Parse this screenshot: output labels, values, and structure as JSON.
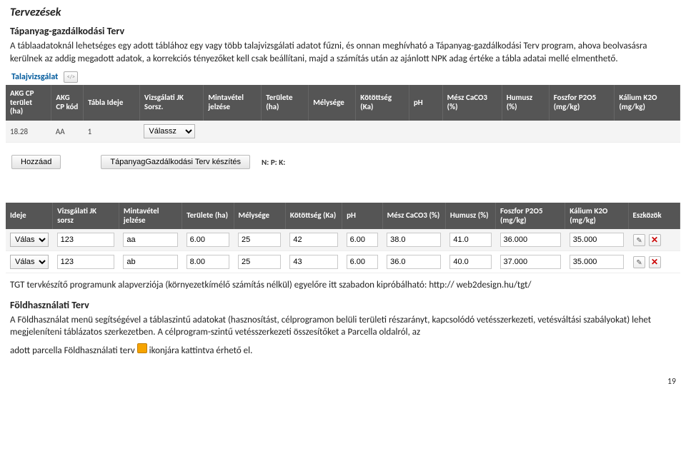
{
  "heading_main": "Tervezések",
  "heading_sub1": "Tápanyag-gazdálkodási Terv",
  "intro_para1": "A táblaadatoknál lehetséges egy adott táblához egy vagy több talajvizsgálati adatot fűzni, és onnan meghívható a Tápanyag-gazdálkodási Terv program, ahova beolvasásra kerülnek az addig megadott adatok, a korrekciós tényezőket kell csak beállítani, majd a számítás után az ajánlott NPK adag értéke a tábla adatai mellé elmenthető.",
  "bar1_label": "Talajvizsgálat",
  "table1": {
    "headers": [
      "AKG CP terület (ha)",
      "AKG CP kód",
      "Tábla Ideje",
      "Vizsgálati JK Sorsz.",
      "Mintavétel jelzése",
      "Területe (ha)",
      "Mélysége",
      "Kötöttség (Ka)",
      "pH",
      "Mész CaCO3 (%)",
      "Humusz (%)",
      "Foszfor P2O5 (mg/kg)",
      "Kálium K2O (mg/kg)"
    ],
    "row": {
      "akg_ha": "18.28",
      "akg_kod": "AA",
      "tabla_ideje": "1",
      "select_label": "Válassz"
    }
  },
  "btn_hozzaad": "Hozzáad",
  "btn_tgt": "TápanyagGazdálkodási Terv készítés",
  "npk_label": "N: P: K:",
  "table2": {
    "headers": [
      "Ideje",
      "Vizsgálati JK sorsz",
      "Mintavétel jelzése",
      "Területe (ha)",
      "Mélysége",
      "Kötöttség (Ka)",
      "pH",
      "Mész CaCO3 (%)",
      "Humusz (%)",
      "Foszfor P2O5 (mg/kg)",
      "Kálium K2O (mg/kg)",
      "Eszközök"
    ],
    "rows": [
      {
        "sel": "Válassz",
        "jk": "123",
        "mv": "aa",
        "ha": "6.00",
        "mely": "25",
        "ka": "42",
        "ph": "6.00",
        "mesz": "38.0",
        "humusz": "41.0",
        "fosz": "36.000",
        "kal": "35.000"
      },
      {
        "sel": "Válassz",
        "jk": "123",
        "mv": "ab",
        "ha": "8.00",
        "mely": "25",
        "ka": "43",
        "ph": "6.00",
        "mesz": "36.0",
        "humusz": "40.0",
        "fosz": "37.000",
        "kal": "35.000"
      }
    ]
  },
  "after_tables_line": "TGT tervkészítő programunk alapverziója (környezetkímélő számítás nélkül) egyelőre itt szabadon kipróbálható: http:// web2design.hu/tgt/",
  "heading_sub2": "Földhasználati Terv",
  "para2": "A Földhasználat menü segítségével a táblaszintű adatokat (hasznosítást, célprogramon belüli területi részarányt, kapcsolódó vetésszerkezeti, vetésváltási szabályokat) lehet megjeleníteni táblázatos szerkezetben. A célprogram-szintű vetésszerkezeti összesítőket a Parcella oldalról, az",
  "para2_line2a": "adott parcella Földhasználati terv ",
  "para2_line2b": " ikonjára kattintva érhető el.",
  "page_num": "19"
}
